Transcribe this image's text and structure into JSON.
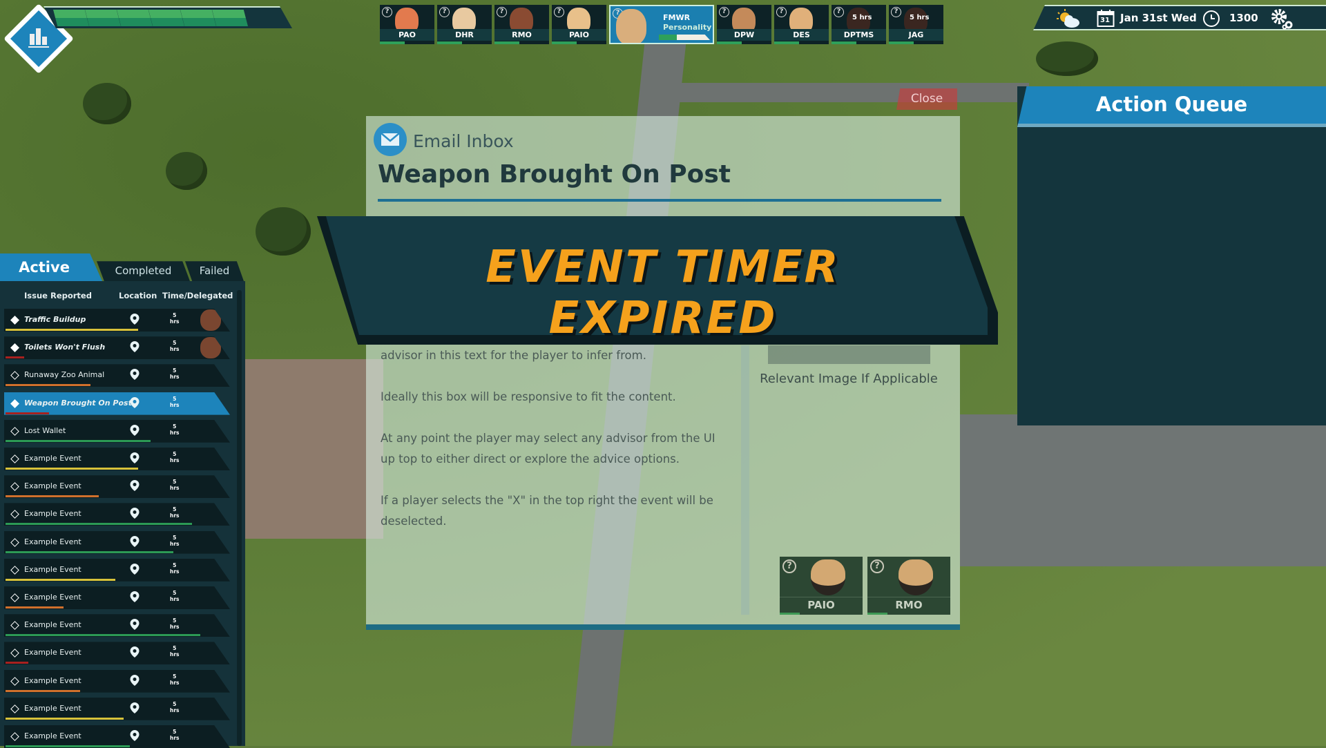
{
  "top_left": {
    "status_bar_filled_segments": 6,
    "status_bar_total_segments": 7
  },
  "advisors": [
    {
      "code": "PAO",
      "face": "#e27a4e"
    },
    {
      "code": "DHR",
      "face": "#e8c9a0"
    },
    {
      "code": "RMO",
      "face": "#8a4b32"
    },
    {
      "code": "PAIO",
      "face": "#e8c08a"
    },
    {
      "code": "FMWR",
      "face": "#d9ae7c",
      "selected": true,
      "title": "Personality",
      "progress": 0.35
    },
    {
      "code": "DPW",
      "face": "#c48a5a"
    },
    {
      "code": "DES",
      "face": "#e0b07a"
    },
    {
      "code": "DPTMS",
      "face": "#3a2620",
      "time": "5 hrs"
    },
    {
      "code": "JAG",
      "face": "#3a2620",
      "time": "5 hrs"
    }
  ],
  "status": {
    "weather_icon": "partly-cloudy-icon",
    "calendar_day": "31",
    "date": "Jan 31st Wed",
    "time": "1300",
    "settings_icon": "gear-icon"
  },
  "issues_panel": {
    "tabs": {
      "active": "Active",
      "completed": "Completed",
      "failed": "Failed"
    },
    "headers": {
      "issue": "Issue Reported",
      "location": "Location",
      "time": "Time/Delegated"
    },
    "rows": [
      {
        "name": "Traffic Buildup",
        "time": "5\nhrs",
        "bold": true,
        "delegated": true,
        "bar_color": "#d8c23a",
        "progress": 0.64
      },
      {
        "name": "Toilets Won't Flush",
        "time": "5\nhrs",
        "bold": true,
        "delegated": true,
        "bar_color": "#a8211f",
        "progress": 0.09
      },
      {
        "name": "Runaway Zoo Animal",
        "time": "5\nhrs",
        "bar_color": "#d0702c",
        "progress": 0.41
      },
      {
        "name": "Weapon Brought On Post",
        "time": "5\nhrs",
        "bold": true,
        "selected": true,
        "bar_color": "#a8211f",
        "progress": 0.21
      },
      {
        "name": "Lost Wallet",
        "time": "5\nhrs",
        "bar_color": "#2c9a55",
        "progress": 0.7
      },
      {
        "name": "Example Event",
        "time": "5\nhrs",
        "bar_color": "#d8c23a",
        "progress": 0.64
      },
      {
        "name": "Example Event",
        "time": "5\nhrs",
        "bar_color": "#d0702c",
        "progress": 0.45
      },
      {
        "name": "Example Event",
        "time": "5\nhrs",
        "bar_color": "#2c9a55",
        "progress": 0.9
      },
      {
        "name": "Example Event",
        "time": "5\nhrs",
        "bar_color": "#2c9a55",
        "progress": 0.81
      },
      {
        "name": "Example Event",
        "time": "5\nhrs",
        "bar_color": "#d8c23a",
        "progress": 0.53
      },
      {
        "name": "Example Event",
        "time": "5\nhrs",
        "bar_color": "#d0702c",
        "progress": 0.28
      },
      {
        "name": "Example Event",
        "time": "5\nhrs",
        "bar_color": "#2c9a55",
        "progress": 0.94
      },
      {
        "name": "Example Event",
        "time": "5\nhrs",
        "bar_color": "#a8211f",
        "progress": 0.11
      },
      {
        "name": "Example Event",
        "time": "5\nhrs",
        "bar_color": "#d0702c",
        "progress": 0.36
      },
      {
        "name": "Example Event",
        "time": "5\nhrs",
        "bar_color": "#d8c23a",
        "progress": 0.57
      },
      {
        "name": "Example Event",
        "time": "5\nhrs",
        "bar_color": "#2c9a55",
        "progress": 0.6
      }
    ]
  },
  "dialog": {
    "close": "Close",
    "inbox": "Email Inbox",
    "title": "Weapon Brought On Post",
    "banner": "EVENT TIMER EXPIRED",
    "body": [
      "advisor in this text for the player to infer from.",
      "Ideally this box will be responsive to fit the content.",
      "At any point the player may select any advisor from the UI",
      "up top to either direct or explore the advice options.",
      "If a player selects the \"X\" in the top right the event will be",
      "deselected."
    ],
    "image_label": "Relevant Image If Applicable",
    "advisors": [
      "PAIO",
      "RMO"
    ]
  },
  "action_queue": {
    "title": "Action Queue"
  }
}
